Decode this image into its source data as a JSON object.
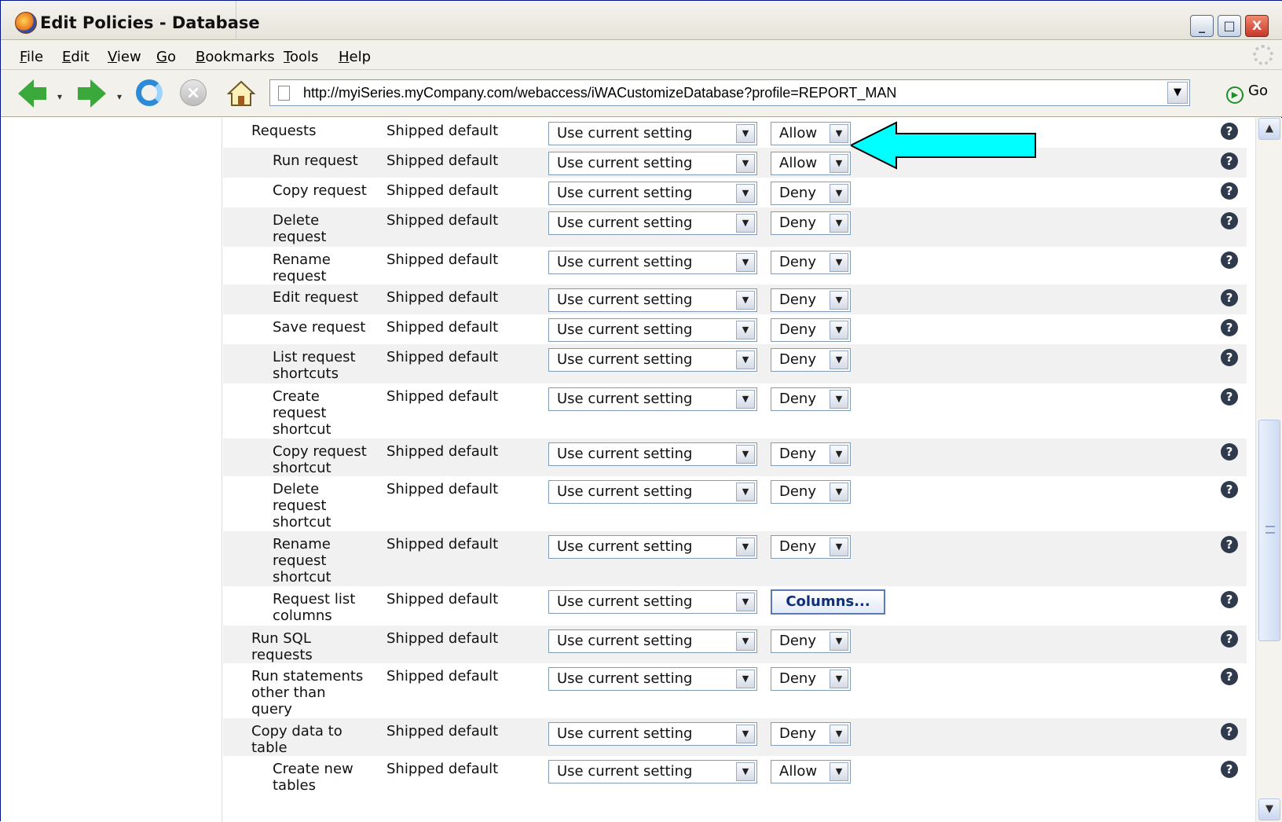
{
  "window": {
    "title": "Edit Policies - Database",
    "controls": {
      "minimize": "_",
      "maximize": "□",
      "close": "X"
    }
  },
  "menu": [
    {
      "label": "File",
      "key": "F",
      "rest": "ile"
    },
    {
      "label": "Edit",
      "key": "E",
      "rest": "dit"
    },
    {
      "label": "View",
      "key": "V",
      "rest": "iew"
    },
    {
      "label": "Go",
      "key": "G",
      "rest": "o"
    },
    {
      "label": "Bookmarks",
      "key": "B",
      "rest": "ookmarks"
    },
    {
      "label": "Tools",
      "key": "T",
      "rest": "ools"
    },
    {
      "label": "Help",
      "key": "H",
      "rest": "elp"
    }
  ],
  "navbar": {
    "url": "http://myiSeries.myCompany.com/webaccess/iWACustomizeDatabase?profile=REPORT_MAN",
    "go_label": "Go"
  },
  "policies": [
    {
      "name": "Requests",
      "indent": 1,
      "source": "Shipped default",
      "setting": "Use current setting",
      "value": "Allow",
      "type": "select",
      "highlighted": true
    },
    {
      "name": "Run request",
      "indent": 2,
      "source": "Shipped default",
      "setting": "Use current setting",
      "value": "Allow",
      "type": "select"
    },
    {
      "name": "Copy request",
      "indent": 2,
      "source": "Shipped default",
      "setting": "Use current setting",
      "value": "Deny",
      "type": "select"
    },
    {
      "name": "Delete request",
      "indent": 2,
      "source": "Shipped default",
      "setting": "Use current setting",
      "value": "Deny",
      "type": "select"
    },
    {
      "name": "Rename request",
      "indent": 2,
      "source": "Shipped default",
      "setting": "Use current setting",
      "value": "Deny",
      "type": "select"
    },
    {
      "name": "Edit request",
      "indent": 2,
      "source": "Shipped default",
      "setting": "Use current setting",
      "value": "Deny",
      "type": "select"
    },
    {
      "name": "Save request",
      "indent": 2,
      "source": "Shipped default",
      "setting": "Use current setting",
      "value": "Deny",
      "type": "select"
    },
    {
      "name": "List request shortcuts",
      "indent": 2,
      "source": "Shipped default",
      "setting": "Use current setting",
      "value": "Deny",
      "type": "select"
    },
    {
      "name": "Create request shortcut",
      "indent": 2,
      "source": "Shipped default",
      "setting": "Use current setting",
      "value": "Deny",
      "type": "select"
    },
    {
      "name": "Copy request shortcut",
      "indent": 2,
      "source": "Shipped default",
      "setting": "Use current setting",
      "value": "Deny",
      "type": "select"
    },
    {
      "name": "Delete request shortcut",
      "indent": 2,
      "source": "Shipped default",
      "setting": "Use current setting",
      "value": "Deny",
      "type": "select"
    },
    {
      "name": "Rename request shortcut",
      "indent": 2,
      "source": "Shipped default",
      "setting": "Use current setting",
      "value": "Deny",
      "type": "select"
    },
    {
      "name": "Request list columns",
      "indent": 2,
      "source": "Shipped default",
      "setting": "Use current setting",
      "value": "Columns...",
      "type": "button"
    },
    {
      "name": "Run SQL requests",
      "indent": 1,
      "source": "Shipped default",
      "setting": "Use current setting",
      "value": "Deny",
      "type": "select"
    },
    {
      "name": "Run statements other than query",
      "indent": 1,
      "source": "Shipped default",
      "setting": "Use current setting",
      "value": "Deny",
      "type": "select"
    },
    {
      "name": "Copy data to table",
      "indent": 1,
      "source": "Shipped default",
      "setting": "Use current setting",
      "value": "Deny",
      "type": "select"
    },
    {
      "name": "Create new tables",
      "indent": 2,
      "source": "Shipped default",
      "setting": "Use current setting",
      "value": "Allow",
      "type": "select"
    }
  ],
  "help_glyph": "?",
  "colors": {
    "callout_arrow": "#00ffff",
    "row_alt": "#f1f1f1",
    "button_text": "#12307a"
  },
  "icons": [
    "back-icon",
    "forward-icon",
    "reload-icon",
    "stop-icon",
    "home-icon",
    "page-icon",
    "go-icon",
    "help-icon"
  ]
}
